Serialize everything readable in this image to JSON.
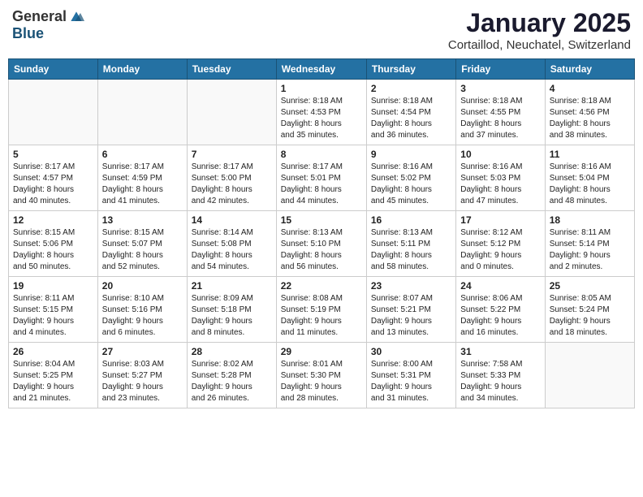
{
  "logo": {
    "general": "General",
    "blue": "Blue"
  },
  "title": "January 2025",
  "location": "Cortaillod, Neuchatel, Switzerland",
  "weekdays": [
    "Sunday",
    "Monday",
    "Tuesday",
    "Wednesday",
    "Thursday",
    "Friday",
    "Saturday"
  ],
  "weeks": [
    [
      {
        "day": "",
        "info": ""
      },
      {
        "day": "",
        "info": ""
      },
      {
        "day": "",
        "info": ""
      },
      {
        "day": "1",
        "info": "Sunrise: 8:18 AM\nSunset: 4:53 PM\nDaylight: 8 hours\nand 35 minutes."
      },
      {
        "day": "2",
        "info": "Sunrise: 8:18 AM\nSunset: 4:54 PM\nDaylight: 8 hours\nand 36 minutes."
      },
      {
        "day": "3",
        "info": "Sunrise: 8:18 AM\nSunset: 4:55 PM\nDaylight: 8 hours\nand 37 minutes."
      },
      {
        "day": "4",
        "info": "Sunrise: 8:18 AM\nSunset: 4:56 PM\nDaylight: 8 hours\nand 38 minutes."
      }
    ],
    [
      {
        "day": "5",
        "info": "Sunrise: 8:17 AM\nSunset: 4:57 PM\nDaylight: 8 hours\nand 40 minutes."
      },
      {
        "day": "6",
        "info": "Sunrise: 8:17 AM\nSunset: 4:59 PM\nDaylight: 8 hours\nand 41 minutes."
      },
      {
        "day": "7",
        "info": "Sunrise: 8:17 AM\nSunset: 5:00 PM\nDaylight: 8 hours\nand 42 minutes."
      },
      {
        "day": "8",
        "info": "Sunrise: 8:17 AM\nSunset: 5:01 PM\nDaylight: 8 hours\nand 44 minutes."
      },
      {
        "day": "9",
        "info": "Sunrise: 8:16 AM\nSunset: 5:02 PM\nDaylight: 8 hours\nand 45 minutes."
      },
      {
        "day": "10",
        "info": "Sunrise: 8:16 AM\nSunset: 5:03 PM\nDaylight: 8 hours\nand 47 minutes."
      },
      {
        "day": "11",
        "info": "Sunrise: 8:16 AM\nSunset: 5:04 PM\nDaylight: 8 hours\nand 48 minutes."
      }
    ],
    [
      {
        "day": "12",
        "info": "Sunrise: 8:15 AM\nSunset: 5:06 PM\nDaylight: 8 hours\nand 50 minutes."
      },
      {
        "day": "13",
        "info": "Sunrise: 8:15 AM\nSunset: 5:07 PM\nDaylight: 8 hours\nand 52 minutes."
      },
      {
        "day": "14",
        "info": "Sunrise: 8:14 AM\nSunset: 5:08 PM\nDaylight: 8 hours\nand 54 minutes."
      },
      {
        "day": "15",
        "info": "Sunrise: 8:13 AM\nSunset: 5:10 PM\nDaylight: 8 hours\nand 56 minutes."
      },
      {
        "day": "16",
        "info": "Sunrise: 8:13 AM\nSunset: 5:11 PM\nDaylight: 8 hours\nand 58 minutes."
      },
      {
        "day": "17",
        "info": "Sunrise: 8:12 AM\nSunset: 5:12 PM\nDaylight: 9 hours\nand 0 minutes."
      },
      {
        "day": "18",
        "info": "Sunrise: 8:11 AM\nSunset: 5:14 PM\nDaylight: 9 hours\nand 2 minutes."
      }
    ],
    [
      {
        "day": "19",
        "info": "Sunrise: 8:11 AM\nSunset: 5:15 PM\nDaylight: 9 hours\nand 4 minutes."
      },
      {
        "day": "20",
        "info": "Sunrise: 8:10 AM\nSunset: 5:16 PM\nDaylight: 9 hours\nand 6 minutes."
      },
      {
        "day": "21",
        "info": "Sunrise: 8:09 AM\nSunset: 5:18 PM\nDaylight: 9 hours\nand 8 minutes."
      },
      {
        "day": "22",
        "info": "Sunrise: 8:08 AM\nSunset: 5:19 PM\nDaylight: 9 hours\nand 11 minutes."
      },
      {
        "day": "23",
        "info": "Sunrise: 8:07 AM\nSunset: 5:21 PM\nDaylight: 9 hours\nand 13 minutes."
      },
      {
        "day": "24",
        "info": "Sunrise: 8:06 AM\nSunset: 5:22 PM\nDaylight: 9 hours\nand 16 minutes."
      },
      {
        "day": "25",
        "info": "Sunrise: 8:05 AM\nSunset: 5:24 PM\nDaylight: 9 hours\nand 18 minutes."
      }
    ],
    [
      {
        "day": "26",
        "info": "Sunrise: 8:04 AM\nSunset: 5:25 PM\nDaylight: 9 hours\nand 21 minutes."
      },
      {
        "day": "27",
        "info": "Sunrise: 8:03 AM\nSunset: 5:27 PM\nDaylight: 9 hours\nand 23 minutes."
      },
      {
        "day": "28",
        "info": "Sunrise: 8:02 AM\nSunset: 5:28 PM\nDaylight: 9 hours\nand 26 minutes."
      },
      {
        "day": "29",
        "info": "Sunrise: 8:01 AM\nSunset: 5:30 PM\nDaylight: 9 hours\nand 28 minutes."
      },
      {
        "day": "30",
        "info": "Sunrise: 8:00 AM\nSunset: 5:31 PM\nDaylight: 9 hours\nand 31 minutes."
      },
      {
        "day": "31",
        "info": "Sunrise: 7:58 AM\nSunset: 5:33 PM\nDaylight: 9 hours\nand 34 minutes."
      },
      {
        "day": "",
        "info": ""
      }
    ]
  ]
}
